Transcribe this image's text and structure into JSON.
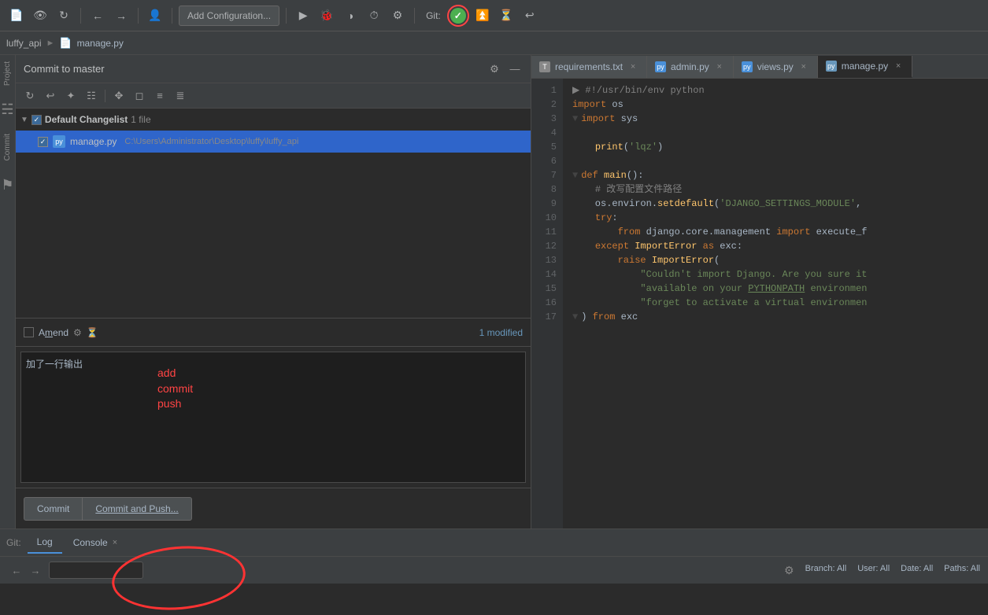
{
  "toolbar": {
    "add_config_label": "Add Configuration...",
    "git_label": "Git:"
  },
  "breadcrumb": {
    "project": "luffy_api",
    "file": "manage.py"
  },
  "commit_panel": {
    "title": "Commit to master",
    "changelist_name": "Default Changelist",
    "changelist_count": "1 file",
    "file_name": "manage.py",
    "file_path": "C:\\Users\\Administrator\\Desktop\\luffy\\luffy_api",
    "amend_label": "Amend",
    "modified_count": "1 modified",
    "commit_message": "加了一行输出",
    "annotation_line1": "add",
    "annotation_line2": "commit",
    "annotation_line3": "push"
  },
  "buttons": {
    "commit_label": "Commit",
    "commit_push_label": "Commit and Push..."
  },
  "editor": {
    "tabs": [
      {
        "name": "requirements.txt",
        "type": "txt",
        "active": false
      },
      {
        "name": "admin.py",
        "type": "py",
        "active": false
      },
      {
        "name": "views.py",
        "type": "py",
        "active": false
      },
      {
        "name": "manage.py",
        "type": "py-active",
        "active": true
      }
    ]
  },
  "code": {
    "lines": [
      {
        "num": 1,
        "content": "#!/usr/bin/env python",
        "type": "shebang"
      },
      {
        "num": 2,
        "content": "import os",
        "type": "import"
      },
      {
        "num": 3,
        "content": "import sys",
        "type": "import"
      },
      {
        "num": 4,
        "content": "",
        "type": "plain"
      },
      {
        "num": 5,
        "content": "    print('lqz')",
        "type": "print"
      },
      {
        "num": 6,
        "content": "",
        "type": "plain"
      },
      {
        "num": 7,
        "content": "def main():",
        "type": "def"
      },
      {
        "num": 8,
        "content": "    # 改写配置文件路径",
        "type": "comment"
      },
      {
        "num": 9,
        "content": "    os.environ.setdefault('DJANGO_SETTINGS_MODULE',",
        "type": "code"
      },
      {
        "num": 10,
        "content": "    try:",
        "type": "code"
      },
      {
        "num": 11,
        "content": "        from django.core.management import execute_f",
        "type": "code"
      },
      {
        "num": 12,
        "content": "    except ImportError as exc:",
        "type": "code"
      },
      {
        "num": 13,
        "content": "        raise ImportError(",
        "type": "code"
      },
      {
        "num": 14,
        "content": "            \"Couldn't import Django. Are you sure it",
        "type": "code"
      },
      {
        "num": 15,
        "content": "            \"available on your PYTHONPATH environmen",
        "type": "code"
      },
      {
        "num": 16,
        "content": "            \"forget to activate a virtual environmen",
        "type": "code"
      },
      {
        "num": 17,
        "content": ") from exc",
        "type": "code"
      }
    ]
  },
  "bottom_bar": {
    "git_label": "Git:",
    "log_tab": "Log",
    "console_tab": "Console"
  },
  "status_bar": {
    "branch": "Branch: All",
    "user": "User: All",
    "date": "Date: All",
    "paths": "Paths: All"
  }
}
